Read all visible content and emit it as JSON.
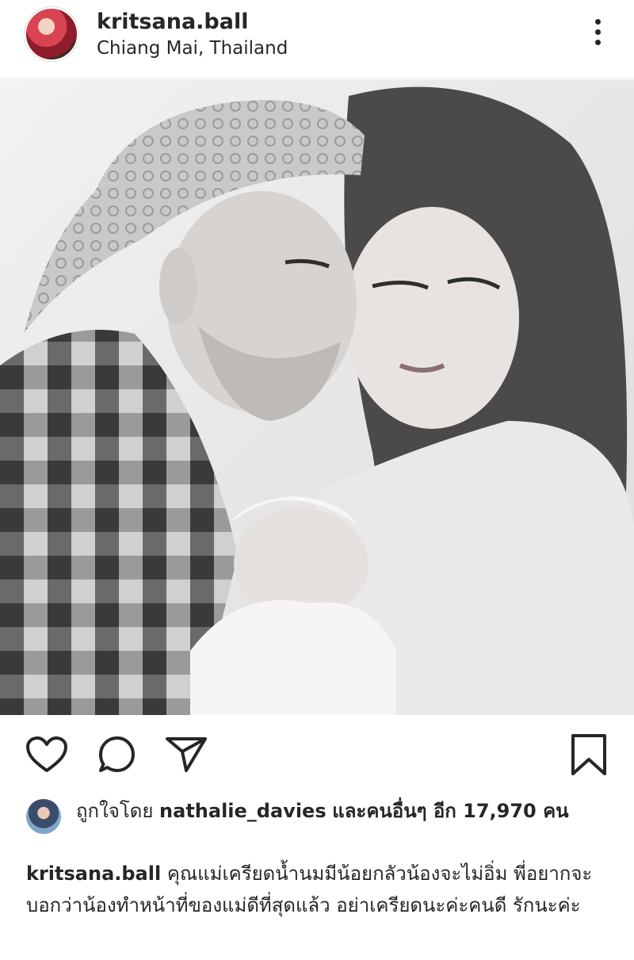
{
  "post": {
    "username": "kritsana.ball",
    "location": "Chiang Mai, Thailand"
  },
  "likes": {
    "prefix": "ถูกใจโดย",
    "user": "nathalie_davies",
    "suffix": "และคนอื่นๆ อีก 17,970 คน"
  },
  "caption": {
    "username": "kritsana.ball",
    "text": "คุณแม่เครียดน้ำนมมีน้อยกลัวน้องจะไม่อิ่ม พี่อยากจะบอกว่าน้องทำหน้าที่ของแม่ดีที่สุดแล้ว อย่าเครียดนะค่ะคนดี รักนะค่ะ"
  },
  "icons": {
    "more": "more-vertical-icon",
    "like": "heart-icon",
    "comment": "comment-icon",
    "share": "send-icon",
    "save": "bookmark-icon"
  },
  "colors": {
    "text": "#262626",
    "divider": "#e6e6e6"
  }
}
